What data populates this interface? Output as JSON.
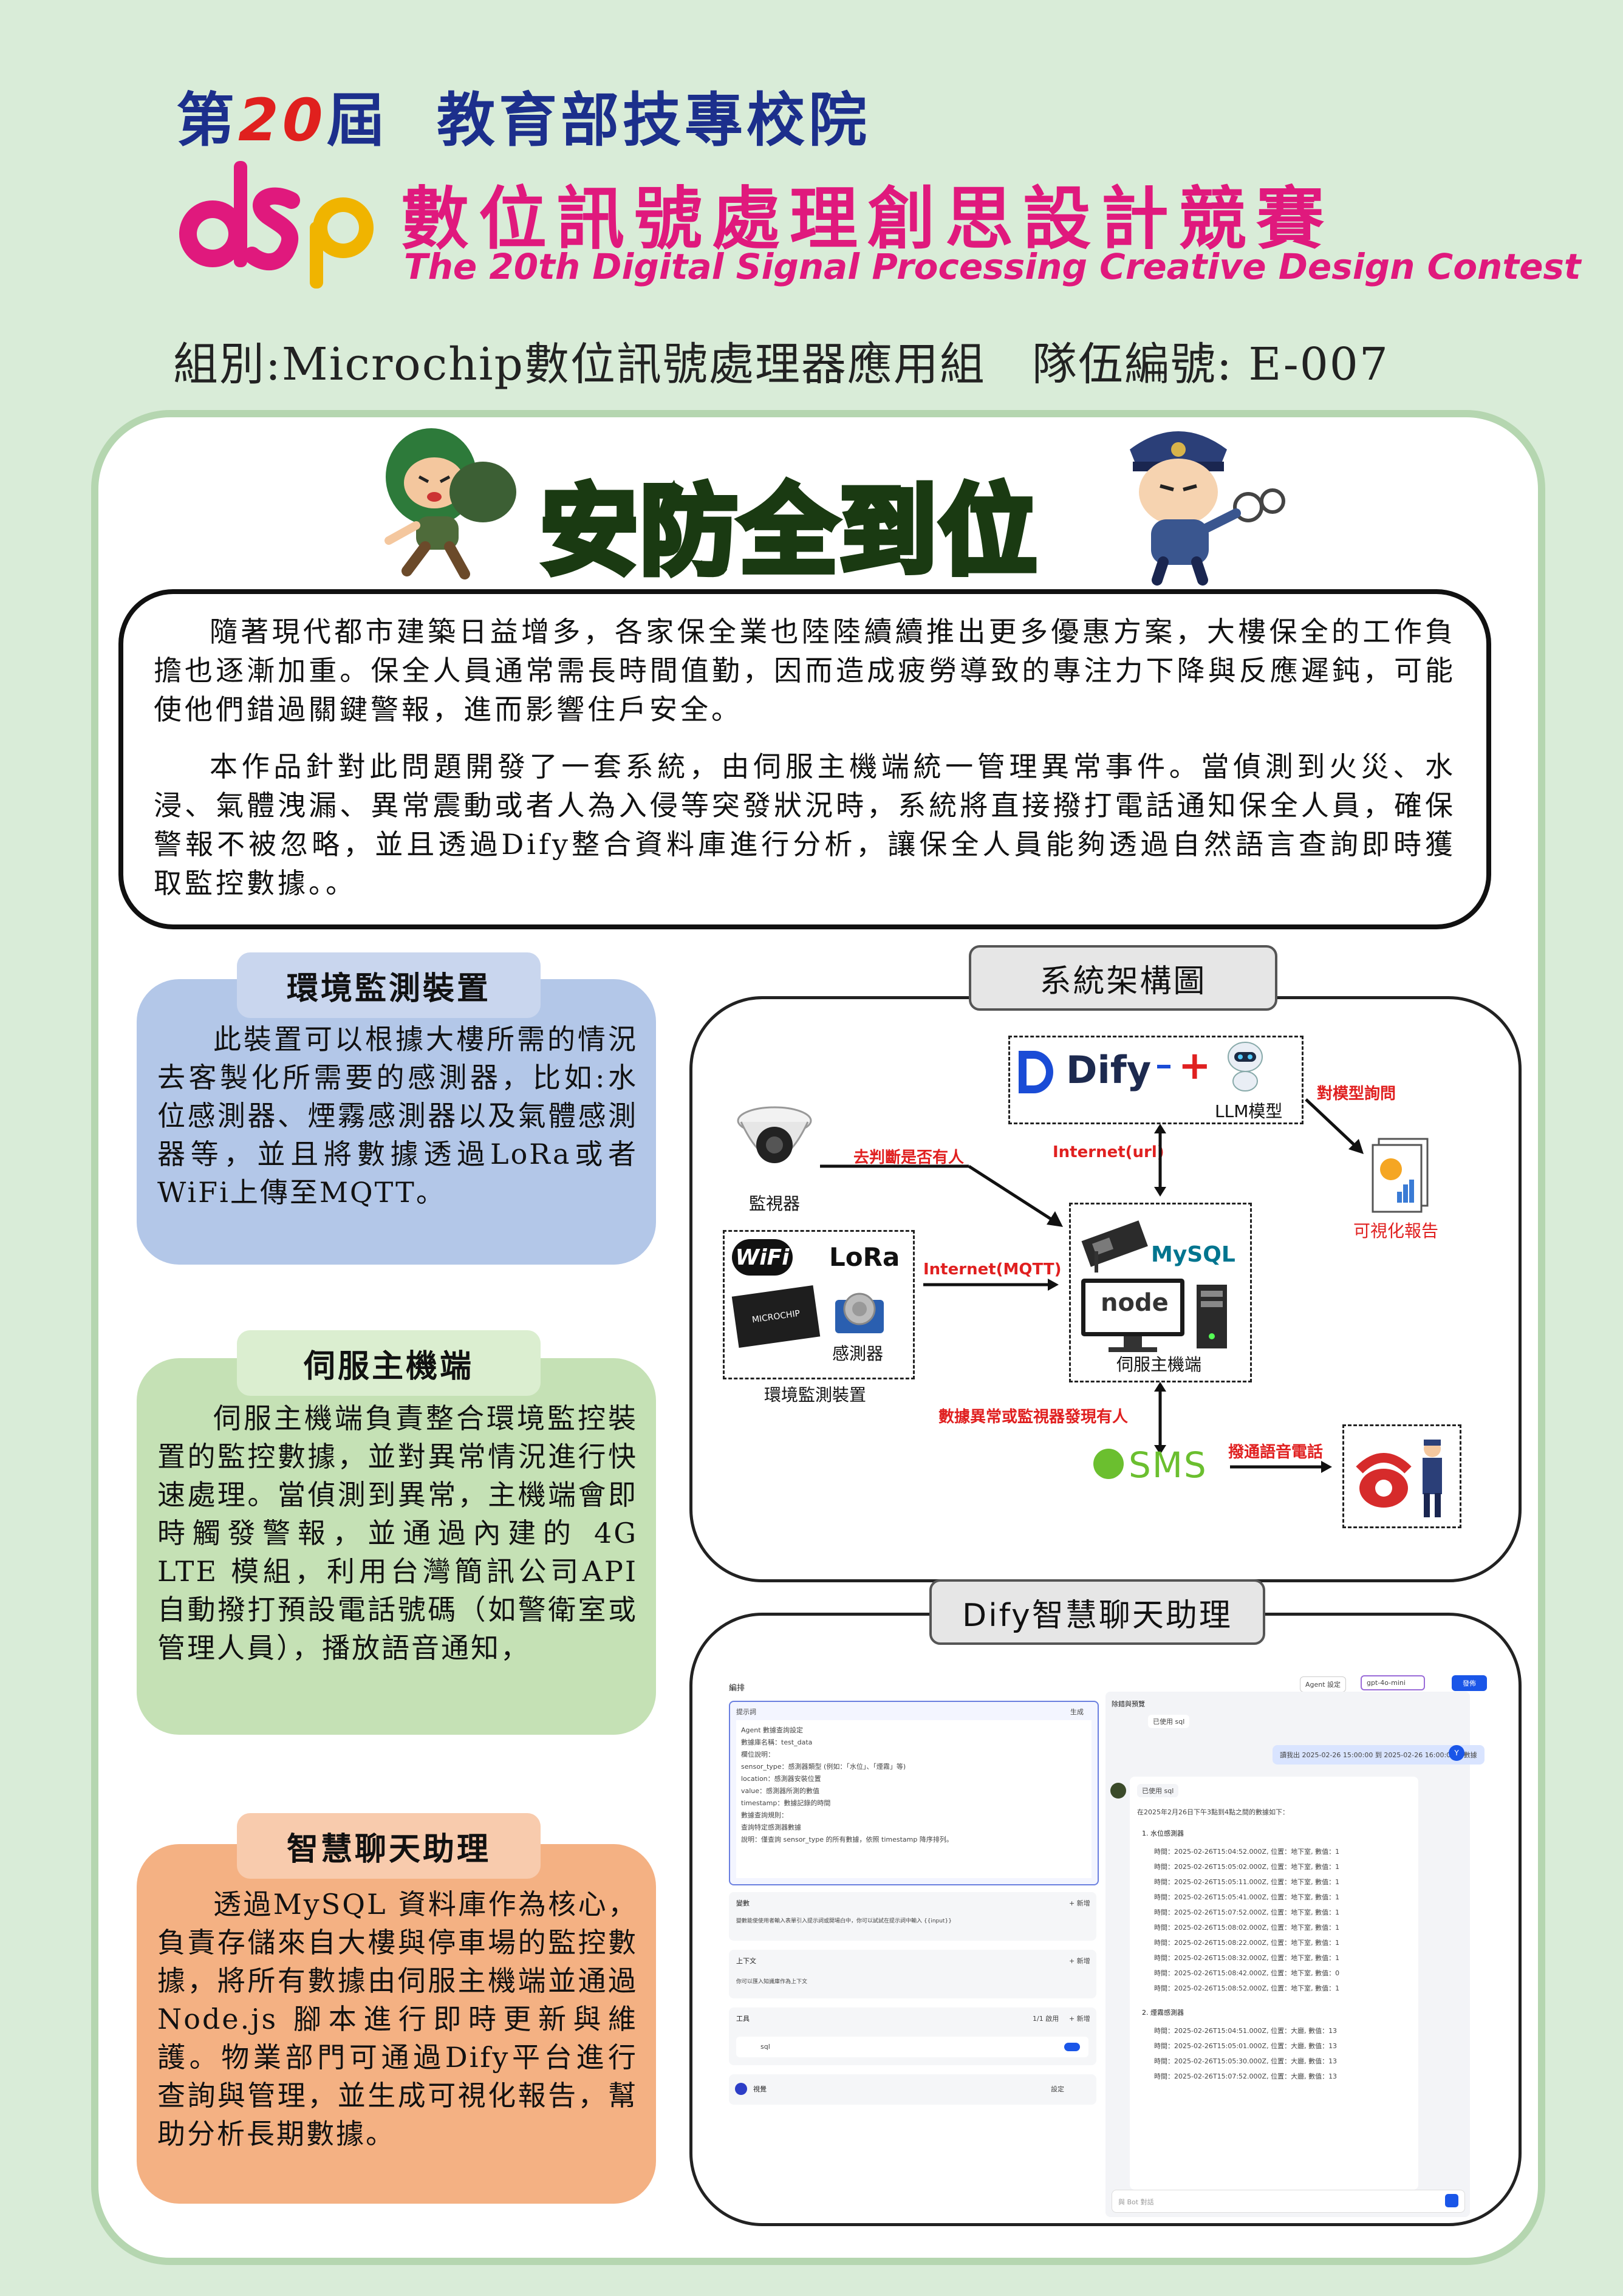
{
  "header": {
    "edition_prefix": "第",
    "edition_num": "20",
    "edition_suffix": "屆",
    "organizer": "教育部技專校院",
    "logo_text": "dsp",
    "title_zh": "數位訊號處理創思設計競賽",
    "title_en": "The 20th Digital Signal Processing Creative Design Contest",
    "group_line": "組別:Microchip數位訊號處理器應用組　隊伍編號: E-007"
  },
  "banner": {
    "title": "安防全到位"
  },
  "intro": {
    "p1": "隨著現代都市建築日益增多，各家保全業也陸陸續續推出更多優惠方案，大樓保全的工作負擔也逐漸加重。保全人員通常需長時間值勤，因而造成疲勞導致的專注力下降與反應遲鈍，可能使他們錯過關鍵警報，進而影響住戶安全。",
    "p2": "本作品針對此問題開發了一套系統，由伺服主機端統一管理異常事件。當偵測到火災、水浸、氣體洩漏、異常震動或者人為入侵等突發狀況時，系統將直接撥打電話通知保全人員，確保警報不被忽略，並且透過Dify整合資料庫進行分析，讓保全人員能夠透過自然語言查詢即時獲取監控數據。。"
  },
  "panels": [
    {
      "title": "環境監測裝置",
      "color": "#b3c7e8",
      "tab_color": "#c9d6ee",
      "text": "此裝置可以根據大樓所需的情況去客製化所需要的感測器，比如:水位感測器、煙霧感測器以及氣體感測器等，並且將數據透過LoRa或者WiFi上傳至MQTT。"
    },
    {
      "title": "伺服主機端",
      "color": "#c5e1b5",
      "tab_color": "#dbeed0",
      "text": "伺服主機端負責整合環境監控裝置的監控數據，並對異常情況進行快速處理。當偵測到異常，主機端會即時觸發警報，並通過內建的 4G LTE 模組，利用台灣簡訊公司API自動撥打預設電話號碼（如警衛室或管理人員），播放語音通知，"
    },
    {
      "title": "智慧聊天助理",
      "color": "#f4b183",
      "tab_color": "#f8cbad",
      "text": "透過MySQL 資料庫作為核心，負責存儲來自大樓與停車場的監控數據，將所有數據由伺服主機端並通過 Node.js 腳本進行即時更新與維護。物業部門可通過Dify平台進行查詢與管理，並生成可視化報告，幫助分析長期數據。"
    }
  ],
  "architecture": {
    "title": "系統架構圖",
    "dify_label": "Dify",
    "plus": "+",
    "llm_label": "LLM模型",
    "query_label": "對模型詢問",
    "report_label": "可視化報告",
    "internet_url": "Internet(url)",
    "judge_label": "去判斷是否有人",
    "camera_label": "監視器",
    "internet_mqtt": "Internet(MQTT)",
    "wifi": "WiFi",
    "lora": "LoRa",
    "microchip": "MICROCHIP",
    "sensor_label": "感測器",
    "env_label": "環境監測裝置",
    "mysql": "MySQL",
    "node": "node",
    "server_label": "伺服主機端",
    "alert_label": "數據異常或監視器發現有人",
    "sms": "SMS",
    "call_label": "撥通語音電話"
  },
  "chat": {
    "title": "Dify智慧聊天助理",
    "screen": {
      "left_title": "編排",
      "agent_btn": "Agent 設定",
      "model": "gpt-4o-mini",
      "publish": "發佈",
      "prompt_title": "提示詞",
      "prompt_gen": "生成",
      "prompt_lines": [
        "Agent 數據查詢設定",
        "數據庫名稱：test_data",
        "欄位說明：",
        "sensor_type：感測器類型 (例如：「水位」、「煙霧」等)",
        "location：感測器安裝位置",
        "value：感測器所測的數值",
        "timestamp：數據記錄的時間",
        "數據查詢規則：",
        "查詢特定感測器數據",
        "說明：僅查詢 sensor_type 的所有數據，依照 timestamp 降序排列。"
      ],
      "var_title": "變數",
      "var_desc": "變數能使使用者輸入表單引入提示詞或開場白中，你可以試試在提示詞中輸入 {{input}}",
      "ctx_title": "上下文",
      "ctx_desc": "你可以匯入知識庫作為上下文",
      "tools_title": "工具",
      "tools_count": "1/1 啟用",
      "tool_name": "sql",
      "vision_title": "視覺",
      "vision_setting": "設定",
      "add": "+ 新增",
      "debug_title": "除錯與預覽",
      "used_sql_1": "已使用 sql",
      "user_msg": "讀我出 2025-02-26 15:00:00 到 2025-02-26 16:00:00 的數據",
      "user_avatar": "Y",
      "used_sql_2": "已使用 sql",
      "answer_intro": "在2025年2月26日下午3點到4點之間的數據如下：",
      "section1": "1. 水位感測器",
      "water_rows": [
        "時間：2025-02-26T15:04:52.000Z, 位置：地下室, 數值：1",
        "時間：2025-02-26T15:05:02.000Z, 位置：地下室, 數值：1",
        "時間：2025-02-26T15:05:11.000Z, 位置：地下室, 數值：1",
        "時間：2025-02-26T15:05:41.000Z, 位置：地下室, 數值：1",
        "時間：2025-02-26T15:07:52.000Z, 位置：地下室, 數值：1",
        "時間：2025-02-26T15:08:02.000Z, 位置：地下室, 數值：1",
        "時間：2025-02-26T15:08:22.000Z, 位置：地下室, 數值：1",
        "時間：2025-02-26T15:08:32.000Z, 位置：地下室, 數值：1",
        "時間：2025-02-26T15:08:42.000Z, 位置：地下室, 數值：0",
        "時間：2025-02-26T15:08:52.000Z, 位置：地下室, 數值：1"
      ],
      "section2": "2. 煙霧感測器",
      "smoke_rows": [
        "時間：2025-02-26T15:04:51.000Z, 位置：大廳, 數值：13",
        "時間：2025-02-26T15:05:01.000Z, 位置：大廳, 數值：13",
        "時間：2025-02-26T15:05:30.000Z, 位置：大廳, 數值：13",
        "時間：2025-02-26T15:07:52.000Z, 位置：大廳, 數值：13"
      ],
      "input_placeholder": "與 Bot 對話"
    }
  }
}
